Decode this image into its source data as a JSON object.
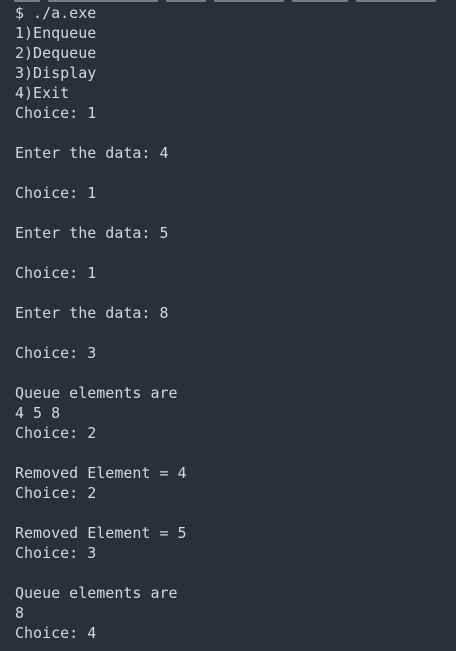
{
  "terminal": {
    "lines": [
      "$ ./a.exe",
      "1)Enqueue",
      "2)Dequeue",
      "3)Display",
      "4)Exit",
      "Choice: 1",
      "",
      "Enter the data: 4",
      "",
      "Choice: 1",
      "",
      "Enter the data: 5",
      "",
      "Choice: 1",
      "",
      "Enter the data: 8",
      "",
      "Choice: 3",
      "",
      "Queue elements are",
      "4 5 8",
      "Choice: 2",
      "",
      "Removed Element = 4",
      "Choice: 2",
      "",
      "Removed Element = 5",
      "Choice: 3",
      "",
      "Queue elements are",
      "8",
      "Choice: 4"
    ]
  }
}
